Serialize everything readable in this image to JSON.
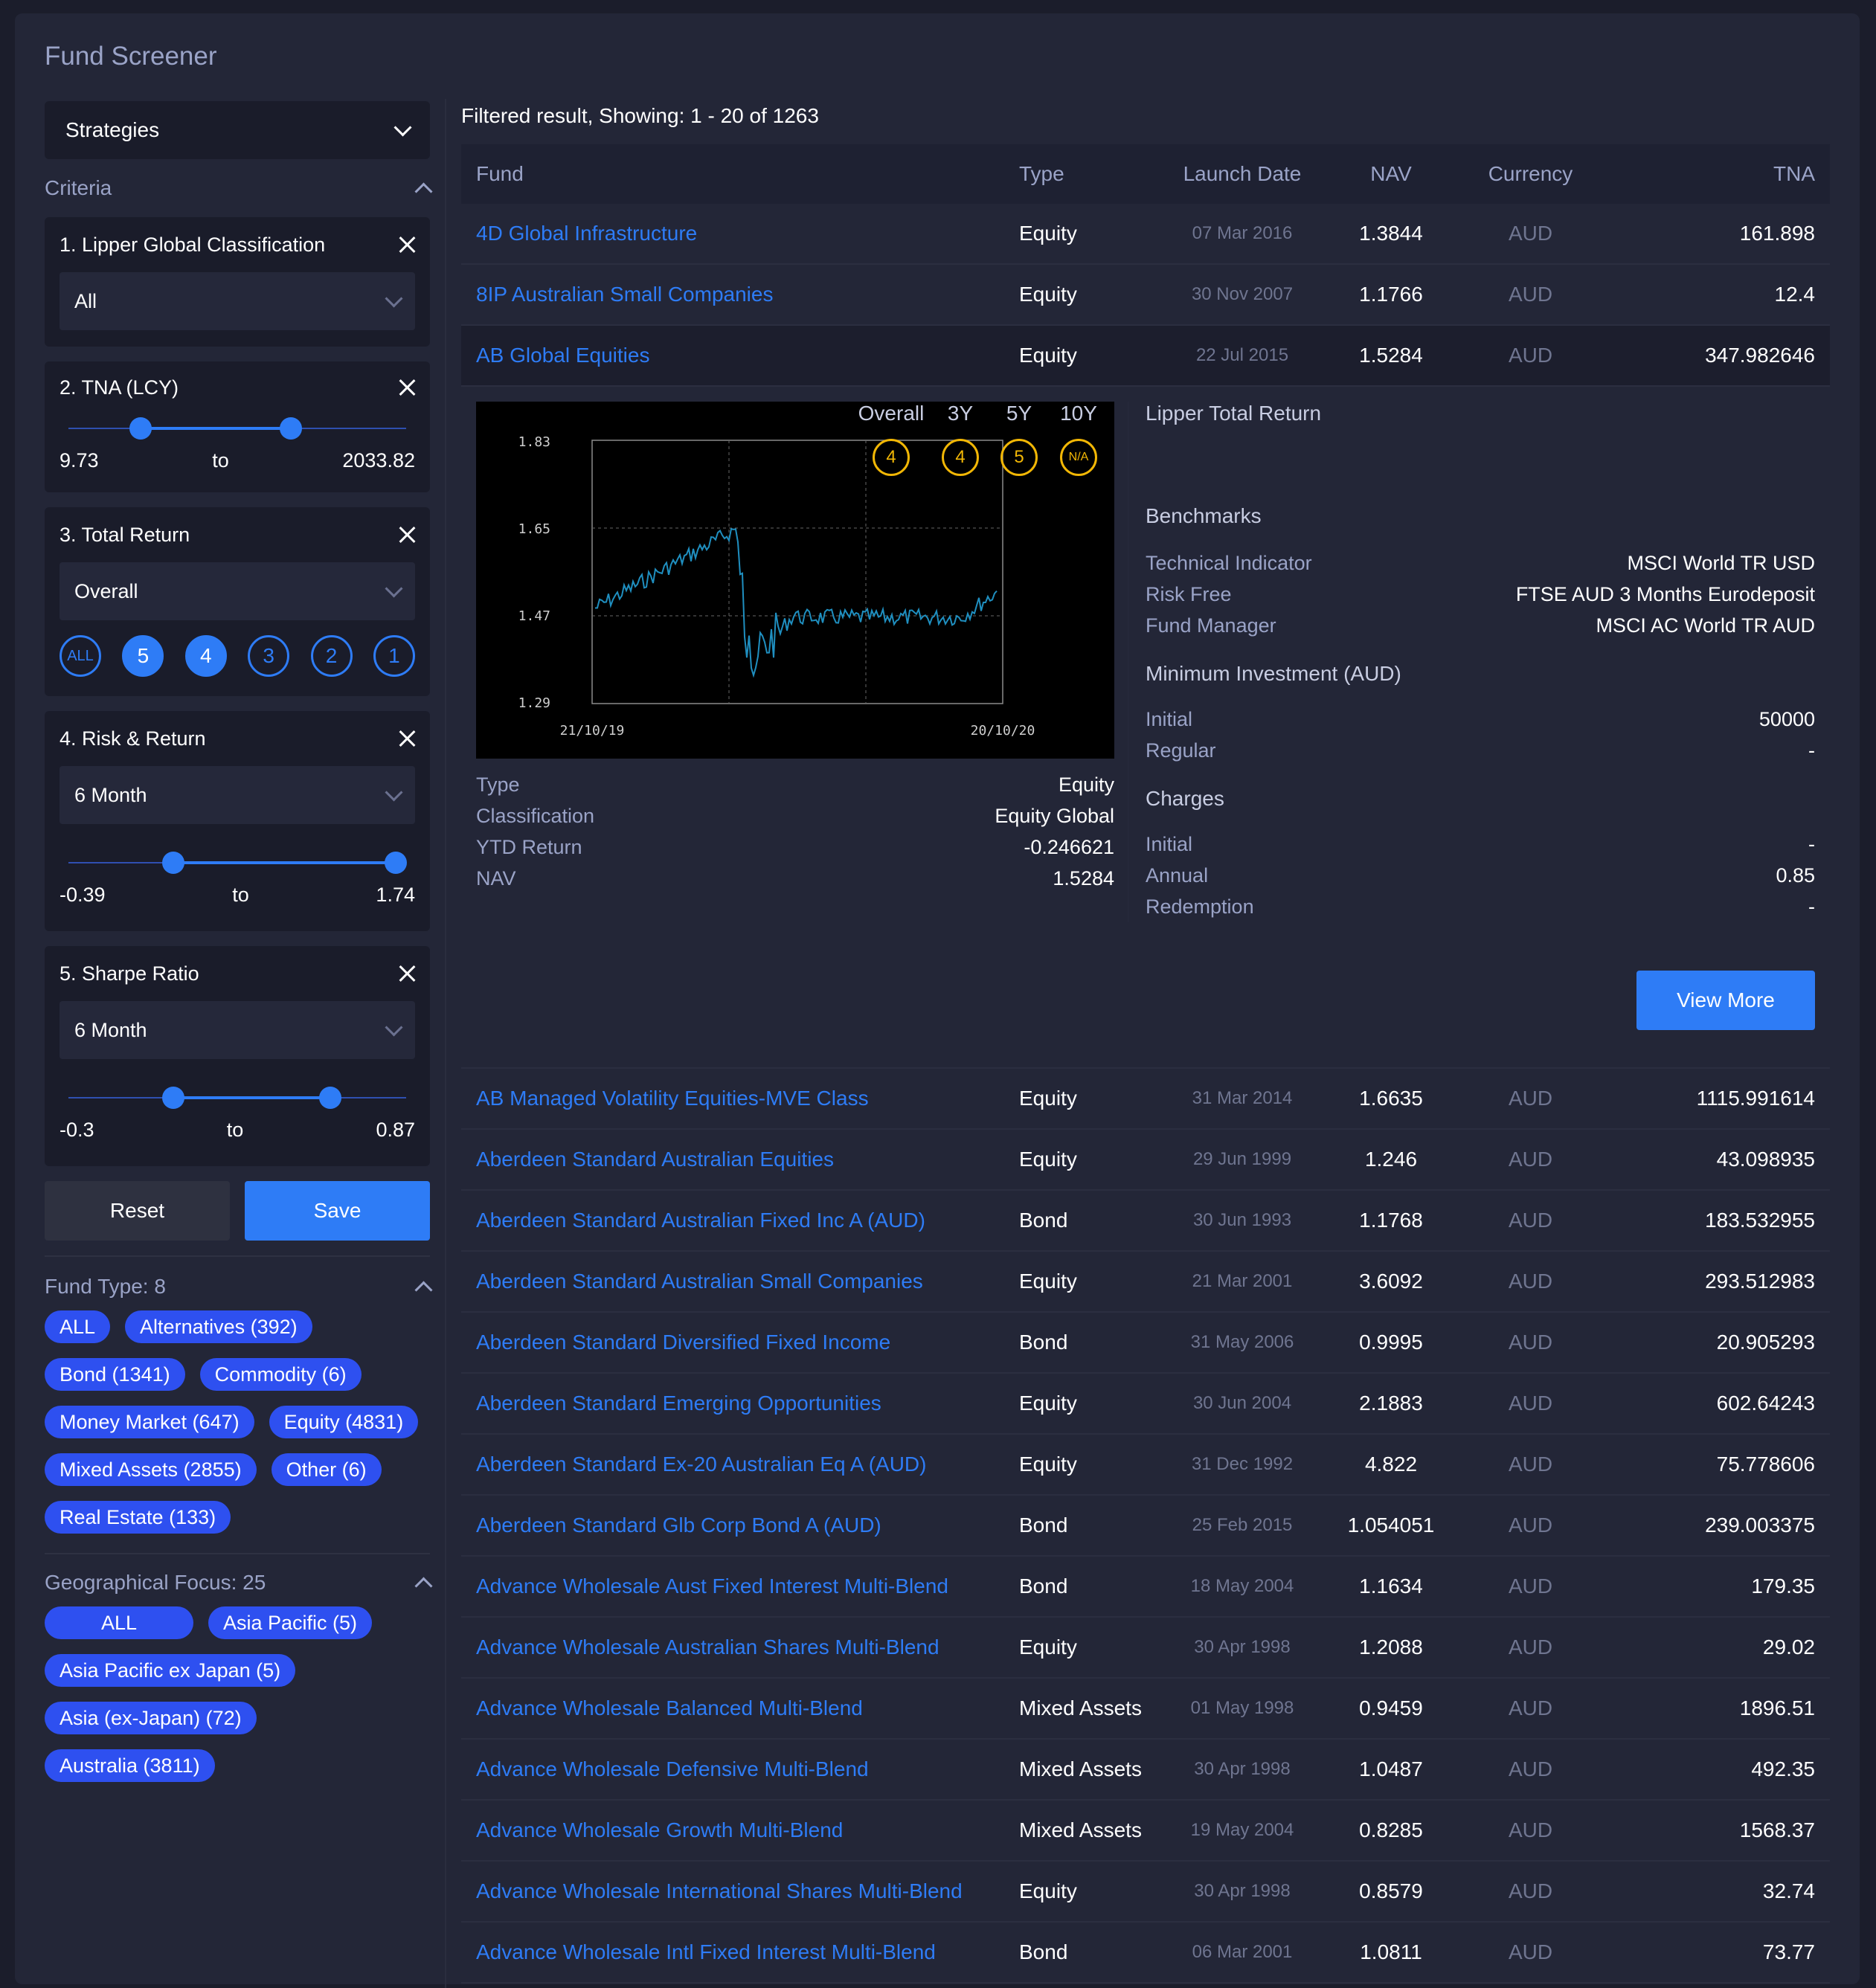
{
  "app": {
    "title": "Fund Screener"
  },
  "sidebar": {
    "strategies_label": "Strategies",
    "criteria_label": "Criteria",
    "filters": {
      "lipper": {
        "title": "1. Lipper Global Classification",
        "value": "All"
      },
      "tna": {
        "title": "2. TNA (LCY)",
        "min": "9.73",
        "to": "to",
        "max": "2033.82",
        "range": [
          0.22,
          0.68
        ]
      },
      "total_return": {
        "title": "3. Total Return",
        "value": "Overall",
        "ratings": [
          "ALL",
          "5",
          "4",
          "3",
          "2",
          "1"
        ],
        "selected": [
          "5",
          "4"
        ]
      },
      "risk_return": {
        "title": "4. Risk & Return",
        "value": "6 Month",
        "min": "-0.39",
        "to": "to",
        "max": "1.74",
        "range": [
          0.32,
          1.0
        ]
      },
      "sharpe": {
        "title": "5. Sharpe Ratio",
        "value": "6 Month",
        "min": "-0.3",
        "to": "to",
        "max": "0.87",
        "range": [
          0.32,
          0.8
        ]
      }
    },
    "reset_label": "Reset",
    "save_label": "Save",
    "fund_type": {
      "title": "Fund Type: 8",
      "chips": [
        "ALL",
        "Alternatives (392)",
        "Bond (1341)",
        "Commodity (6)",
        "Money Market (647)",
        "Equity (4831)",
        "Mixed Assets (2855)",
        "Other (6)",
        "Real Estate (133)"
      ]
    },
    "geo": {
      "title": "Geographical Focus: 25",
      "chips": [
        "ALL",
        "Asia Pacific (5)",
        "Asia Pacific ex Japan (5)",
        "Asia (ex-Japan) (72)",
        "Australia (3811)"
      ]
    }
  },
  "main": {
    "result_text": "Filtered result, Showing: 1 - 20 of 1263",
    "columns": [
      "Fund",
      "Type",
      "Launch Date",
      "NAV",
      "Currency",
      "TNA"
    ],
    "rows_top": [
      [
        "4D Global Infrastructure",
        "Equity",
        "07 Mar 2016",
        "1.3844",
        "AUD",
        "161.898"
      ],
      [
        "8IP Australian Small Companies",
        "Equity",
        "30 Nov 2007",
        "1.1766",
        "AUD",
        "12.4"
      ],
      [
        "AB Global Equities",
        "Equity",
        "22 Jul 2015",
        "1.5284",
        "AUD",
        "347.982646"
      ]
    ],
    "detail": {
      "chart_ticks_y": [
        "1.83",
        "1.65",
        "1.47",
        "1.29"
      ],
      "chart_ticks_x": [
        "21/10/19",
        "20/10/20"
      ],
      "info": [
        {
          "k": "Type",
          "v": "Equity"
        },
        {
          "k": "Classification",
          "v": "Equity Global"
        },
        {
          "k": "YTD Return",
          "v": "-0.246621"
        },
        {
          "k": "NAV",
          "v": "1.5284"
        }
      ],
      "lipper_title": "Lipper Total Return",
      "lipper_cols": [
        "Overall",
        "3Y",
        "5Y",
        "10Y"
      ],
      "lipper_vals": [
        "4",
        "4",
        "5",
        "N/A"
      ],
      "benchmarks_title": "Benchmarks",
      "benchmarks": [
        {
          "k": "Technical Indicator",
          "v": "MSCI World TR USD"
        },
        {
          "k": "Risk Free",
          "v": "FTSE AUD 3 Months Eurodeposit"
        },
        {
          "k": "Fund Manager",
          "v": "MSCI AC World TR AUD"
        }
      ],
      "min_inv_title": "Minimum Investment (AUD)",
      "min_inv": [
        {
          "k": "Initial",
          "v": "50000"
        },
        {
          "k": "Regular",
          "v": "-"
        }
      ],
      "charges_title": "Charges",
      "charges": [
        {
          "k": "Initial",
          "v": "-"
        },
        {
          "k": "Annual",
          "v": "0.85"
        },
        {
          "k": "Redemption",
          "v": "-"
        }
      ],
      "view_more_label": "View More"
    },
    "rows_bottom": [
      [
        "AB Managed Volatility Equities-MVE Class",
        "Equity",
        "31 Mar 2014",
        "1.6635",
        "AUD",
        "1115.991614"
      ],
      [
        "Aberdeen Standard Australian Equities",
        "Equity",
        "29 Jun 1999",
        "1.246",
        "AUD",
        "43.098935"
      ],
      [
        "Aberdeen Standard Australian Fixed Inc A (AUD)",
        "Bond",
        "30 Jun 1993",
        "1.1768",
        "AUD",
        "183.532955"
      ],
      [
        "Aberdeen Standard Australian Small Companies",
        "Equity",
        "21 Mar 2001",
        "3.6092",
        "AUD",
        "293.512983"
      ],
      [
        "Aberdeen Standard Diversified Fixed Income",
        "Bond",
        "31 May 2006",
        "0.9995",
        "AUD",
        "20.905293"
      ],
      [
        "Aberdeen Standard Emerging Opportunities",
        "Equity",
        "30 Jun 2004",
        "2.1883",
        "AUD",
        "602.64243"
      ],
      [
        "Aberdeen Standard Ex-20 Australian Eq A (AUD)",
        "Equity",
        "31 Dec 1992",
        "4.822",
        "AUD",
        "75.778606"
      ],
      [
        "Aberdeen Standard Glb Corp Bond A (AUD)",
        "Bond",
        "25 Feb 2015",
        "1.054051",
        "AUD",
        "239.003375"
      ],
      [
        "Advance Wholesale Aust Fixed Interest Multi-Blend",
        "Bond",
        "18 May 2004",
        "1.1634",
        "AUD",
        "179.35"
      ],
      [
        "Advance Wholesale Australian Shares Multi-Blend",
        "Equity",
        "30 Apr 1998",
        "1.2088",
        "AUD",
        "29.02"
      ],
      [
        "Advance Wholesale Balanced Multi-Blend",
        "Mixed Assets",
        "01 May 1998",
        "0.9459",
        "AUD",
        "1896.51"
      ],
      [
        "Advance Wholesale Defensive Multi-Blend",
        "Mixed Assets",
        "30 Apr 1998",
        "1.0487",
        "AUD",
        "492.35"
      ],
      [
        "Advance Wholesale Growth Multi-Blend",
        "Mixed Assets",
        "19 May 2004",
        "0.8285",
        "AUD",
        "1568.37"
      ],
      [
        "Advance Wholesale International Shares Multi-Blend",
        "Equity",
        "30 Apr 1998",
        "0.8579",
        "AUD",
        "32.74"
      ],
      [
        "Advance Wholesale Intl Fixed Interest Multi-Blend",
        "Bond",
        "06 Mar 2001",
        "1.0811",
        "AUD",
        "73.77"
      ]
    ]
  },
  "colors": {
    "accent": "#2e7cf6",
    "chip": "#2e50f0",
    "rating": "#f2b705",
    "bg": "#232637"
  }
}
